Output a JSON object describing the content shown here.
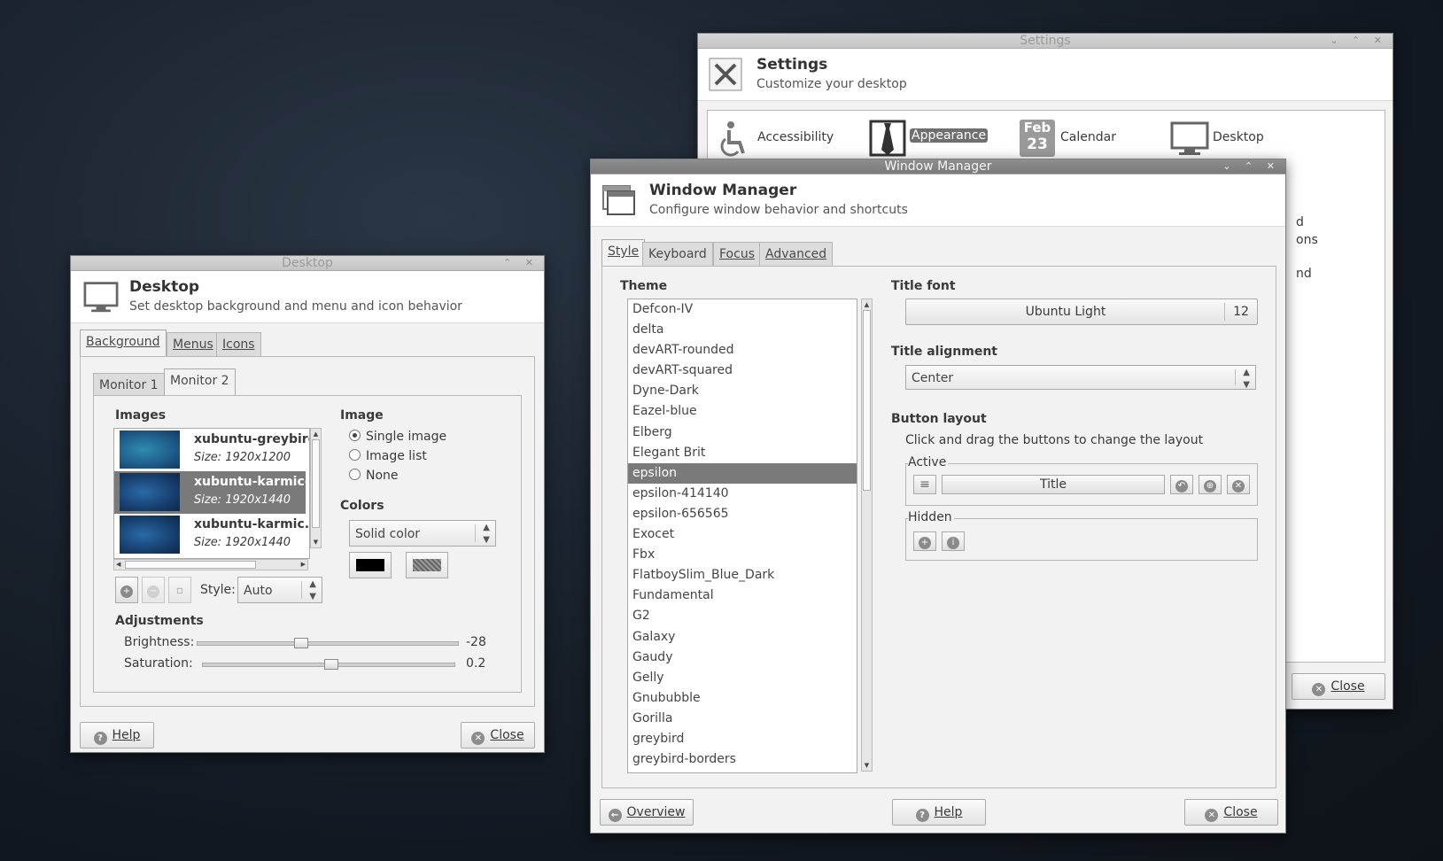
{
  "settings": {
    "window_title": "Settings",
    "header_title": "Settings",
    "header_sub": "Customize your desktop",
    "items": [
      {
        "label": "Accessibility",
        "icon": "accessibility-icon"
      },
      {
        "label": "Appearance",
        "icon": "appearance-icon"
      },
      {
        "label": "Calendar",
        "icon": "calendar-icon",
        "icon_text_top": "Feb",
        "icon_text_bottom": "23"
      },
      {
        "label": "Desktop",
        "icon": "desktop-icon"
      }
    ],
    "partial_labels": [
      "d",
      "ons",
      "nd"
    ],
    "close_label": "Close"
  },
  "wm": {
    "window_title": "Window Manager",
    "header_title": "Window Manager",
    "header_sub": "Configure window behavior and shortcuts",
    "tabs": [
      "Style",
      "Keyboard",
      "Focus",
      "Advanced"
    ],
    "theme_label": "Theme",
    "themes": [
      "Defcon-IV",
      "delta",
      "devART-rounded",
      "devART-squared",
      "Dyne-Dark",
      "Eazel-blue",
      "Elberg",
      "Elegant Brit",
      "epsilon",
      "epsilon-414140",
      "epsilon-656565",
      "Exocet",
      "Fbx",
      "FlatboySlim_Blue_Dark",
      "Fundamental",
      "G2",
      "Galaxy",
      "Gaudy",
      "Gelly",
      "Gnububble",
      "Gorilla",
      "greybird",
      "greybird-borders"
    ],
    "selected_theme": "epsilon",
    "title_font_label": "Title font",
    "title_font_name": "Ubuntu Light",
    "title_font_size": "12",
    "title_alignment_label": "Title alignment",
    "title_alignment_value": "Center",
    "button_layout_label": "Button layout",
    "button_layout_hint": "Click and drag the buttons to change the layout",
    "active_label": "Active",
    "active_title": "Title",
    "hidden_label": "Hidden",
    "overview_label": "Overview",
    "help_label": "Help",
    "close_label": "Close"
  },
  "desktop": {
    "window_title": "Desktop",
    "header_title": "Desktop",
    "header_sub": "Set desktop background and menu and icon behavior",
    "tabs": [
      "Background",
      "Menus",
      "Icons"
    ],
    "monitor_tabs": [
      "Monitor 1",
      "Monitor 2"
    ],
    "images_label": "Images",
    "images": [
      {
        "name": "xubuntu-greybird.",
        "size": "Size: 1920x1200"
      },
      {
        "name": "xubuntu-karmic-g",
        "size": "Size: 1920x1440"
      },
      {
        "name": "xubuntu-karmic.pr",
        "size": "Size: 1920x1440"
      }
    ],
    "image_label": "Image",
    "image_options": [
      "Single image",
      "Image list",
      "None"
    ],
    "colors_label": "Colors",
    "color_mode": "Solid color",
    "style_label": "Style:",
    "style_value": "Auto",
    "adjustments_label": "Adjustments",
    "brightness_label": "Brightness:",
    "brightness_value": "-28",
    "saturation_label": "Saturation:",
    "saturation_value": "0.2",
    "help_label": "Help",
    "close_label": "Close"
  }
}
